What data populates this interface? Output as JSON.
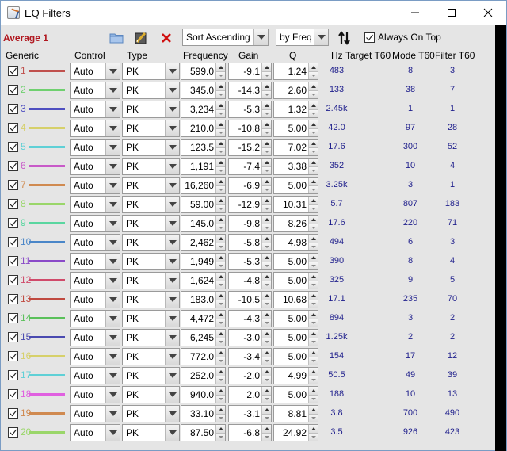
{
  "window": {
    "title": "EQ Filters",
    "controls": [
      "minimize",
      "maximize",
      "close"
    ]
  },
  "toolbar": {
    "profile_name": "Average 1",
    "icons": [
      "folder-icon",
      "edit-icon",
      "delete-icon"
    ],
    "sort_select": "Sort Ascending",
    "sort_by_select": "by Freq",
    "sort_direction_icon": "sort-up-down-icon",
    "always_on_top_label": "Always On Top",
    "always_on_top_checked": true
  },
  "columns": {
    "generic": "Generic",
    "control": "Control",
    "type": "Type",
    "frequency": "Frequency",
    "gain": "Gain",
    "q": "Q",
    "hz": "Hz",
    "target_t60": "Target T60",
    "mode_t60": "Mode T60",
    "filter_t60": "Filter T60"
  },
  "filters": [
    {
      "index": "1",
      "color": "#c0504d",
      "enabled": true,
      "control": "Auto",
      "type": "PK",
      "frequency": "599.0",
      "gain": "-9.1",
      "q": "1.24",
      "hz": "483",
      "mode_t60": "8",
      "filter_t60": "3"
    },
    {
      "index": "2",
      "color": "#6fd06f",
      "enabled": true,
      "control": "Auto",
      "type": "PK",
      "frequency": "345.0",
      "gain": "-14.3",
      "q": "2.60",
      "hz": "133",
      "mode_t60": "38",
      "filter_t60": "7"
    },
    {
      "index": "3",
      "color": "#4f4fc0",
      "enabled": true,
      "control": "Auto",
      "type": "PK",
      "frequency": "3,234",
      "gain": "-5.3",
      "q": "1.32",
      "hz": "2.45k",
      "mode_t60": "1",
      "filter_t60": "1"
    },
    {
      "index": "4",
      "color": "#d6d06a",
      "enabled": true,
      "control": "Auto",
      "type": "PK",
      "frequency": "210.0",
      "gain": "-10.8",
      "q": "5.00",
      "hz": "42.0",
      "mode_t60": "97",
      "filter_t60": "28"
    },
    {
      "index": "5",
      "color": "#5fd0d6",
      "enabled": true,
      "control": "Auto",
      "type": "PK",
      "frequency": "123.5",
      "gain": "-15.2",
      "q": "7.02",
      "hz": "17.6",
      "mode_t60": "300",
      "filter_t60": "52"
    },
    {
      "index": "6",
      "color": "#c85ac8",
      "enabled": true,
      "control": "Auto",
      "type": "PK",
      "frequency": "1,191",
      "gain": "-7.4",
      "q": "3.38",
      "hz": "352",
      "mode_t60": "10",
      "filter_t60": "4"
    },
    {
      "index": "7",
      "color": "#d08a50",
      "enabled": true,
      "control": "Auto",
      "type": "PK",
      "frequency": "16,260",
      "gain": "-6.9",
      "q": "5.00",
      "hz": "3.25k",
      "mode_t60": "3",
      "filter_t60": "1"
    },
    {
      "index": "8",
      "color": "#9ad66a",
      "enabled": true,
      "control": "Auto",
      "type": "PK",
      "frequency": "59.00",
      "gain": "-12.9",
      "q": "10.31",
      "hz": "5.7",
      "mode_t60": "807",
      "filter_t60": "183"
    },
    {
      "index": "9",
      "color": "#5ad6a0",
      "enabled": true,
      "control": "Auto",
      "type": "PK",
      "frequency": "145.0",
      "gain": "-9.8",
      "q": "8.26",
      "hz": "17.6",
      "mode_t60": "220",
      "filter_t60": "71"
    },
    {
      "index": "10",
      "color": "#4a86c8",
      "enabled": true,
      "control": "Auto",
      "type": "PK",
      "frequency": "2,462",
      "gain": "-5.8",
      "q": "4.98",
      "hz": "494",
      "mode_t60": "6",
      "filter_t60": "3"
    },
    {
      "index": "11",
      "color": "#8a4ac8",
      "enabled": true,
      "control": "Auto",
      "type": "PK",
      "frequency": "1,949",
      "gain": "-5.3",
      "q": "5.00",
      "hz": "390",
      "mode_t60": "8",
      "filter_t60": "4"
    },
    {
      "index": "12",
      "color": "#d04a6a",
      "enabled": true,
      "control": "Auto",
      "type": "PK",
      "frequency": "1,624",
      "gain": "-4.8",
      "q": "5.00",
      "hz": "325",
      "mode_t60": "9",
      "filter_t60": "5"
    },
    {
      "index": "13",
      "color": "#c04a40",
      "enabled": true,
      "control": "Auto",
      "type": "PK",
      "frequency": "183.0",
      "gain": "-10.5",
      "q": "10.68",
      "hz": "17.1",
      "mode_t60": "235",
      "filter_t60": "70"
    },
    {
      "index": "14",
      "color": "#5ac05a",
      "enabled": true,
      "control": "Auto",
      "type": "PK",
      "frequency": "4,472",
      "gain": "-4.3",
      "q": "5.00",
      "hz": "894",
      "mode_t60": "3",
      "filter_t60": "2"
    },
    {
      "index": "15",
      "color": "#4a4ab0",
      "enabled": true,
      "control": "Auto",
      "type": "PK",
      "frequency": "6,245",
      "gain": "-3.0",
      "q": "5.00",
      "hz": "1.25k",
      "mode_t60": "2",
      "filter_t60": "2"
    },
    {
      "index": "16",
      "color": "#d6d06a",
      "enabled": true,
      "control": "Auto",
      "type": "PK",
      "frequency": "772.0",
      "gain": "-3.4",
      "q": "5.00",
      "hz": "154",
      "mode_t60": "17",
      "filter_t60": "12"
    },
    {
      "index": "17",
      "color": "#5fd0d6",
      "enabled": true,
      "control": "Auto",
      "type": "PK",
      "frequency": "252.0",
      "gain": "-2.0",
      "q": "4.99",
      "hz": "50.5",
      "mode_t60": "49",
      "filter_t60": "39"
    },
    {
      "index": "18",
      "color": "#e060e0",
      "enabled": true,
      "control": "Auto",
      "type": "PK",
      "frequency": "940.0",
      "gain": "2.0",
      "q": "5.00",
      "hz": "188",
      "mode_t60": "10",
      "filter_t60": "13"
    },
    {
      "index": "19",
      "color": "#d08a50",
      "enabled": true,
      "control": "Auto",
      "type": "PK",
      "frequency": "33.10",
      "gain": "-3.1",
      "q": "8.81",
      "hz": "3.8",
      "mode_t60": "700",
      "filter_t60": "490"
    },
    {
      "index": "20",
      "color": "#9ad66a",
      "enabled": true,
      "control": "Auto",
      "type": "PK",
      "frequency": "87.50",
      "gain": "-6.8",
      "q": "24.92",
      "hz": "3.5",
      "mode_t60": "926",
      "filter_t60": "423"
    }
  ]
}
